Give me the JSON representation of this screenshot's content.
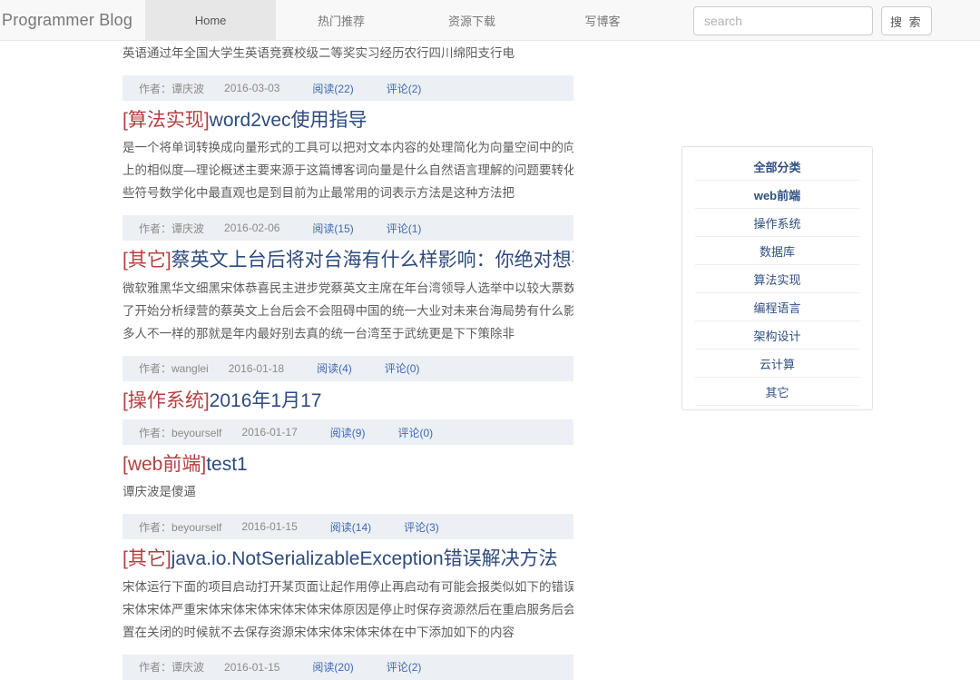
{
  "navbar": {
    "brand": "Programmer Blog",
    "items": [
      {
        "label": "Home",
        "active": true
      },
      {
        "label": "热门推荐",
        "active": false
      },
      {
        "label": "资源下载",
        "active": false
      },
      {
        "label": "写博客",
        "active": false
      }
    ],
    "search": {
      "placeholder": "search",
      "value": "",
      "button_label": "搜 索"
    }
  },
  "articles": [
    {
      "category": "",
      "title": "",
      "body_lines": [
        "英语通过年全国大学生英语竞赛校级二等奖实习经历农行四川绵阳支行电"
      ],
      "meta": {
        "author_label": "作者：",
        "author": "谭庆波",
        "date": "2016-03-03",
        "read": "阅读(22)",
        "comment": "评论(2)"
      }
    },
    {
      "category": "[算法实现]",
      "title": "word2vec使用指导",
      "body_lines": [
        "是一个将单词转换成向量形式的工具可以把对文本内容的处理简化为向量空间中的向量运算计算",
        "上的相似度—理论概述主要来源于这篇博客词向量是什么自然语言理解的问题要转化为机器学习",
        "些符号数学化中最直观也是到目前为止最常用的词表示方法是这种方法把"
      ],
      "meta": {
        "author_label": "作者：",
        "author": "谭庆波",
        "date": "2016-02-06",
        "read": "阅读(15)",
        "comment": "评论(1)"
      }
    },
    {
      "category": "[其它]",
      "title": "蔡英文上台后将对台海有什么样影响：你绝对想不到",
      "body_lines": [
        "微软雅黑华文细黑宋体恭喜民主进步党蔡英文主席在年台湾领导人选举中以较大票数优势成功当",
        "了开始分析绿营的蔡英文上台后会不会阻碍中国的统一大业对未来台海局势有什么影响微软雅黑",
        "多人不一样的那就是年内最好别去真的统一台湾至于武统更是下下策除非"
      ],
      "meta": {
        "author_label": "作者：",
        "author": "wanglei",
        "date": "2016-01-18",
        "read": "阅读(4)",
        "comment": "评论(0)"
      }
    },
    {
      "category": "[操作系统]",
      "title": "2016年1月17",
      "body_lines": [],
      "meta": {
        "author_label": "作者：",
        "author": "beyourself",
        "date": "2016-01-17",
        "read": "阅读(9)",
        "comment": "评论(0)"
      }
    },
    {
      "category": "[web前端]",
      "title": "test1",
      "body_lines": [
        "谭庆波是傻逼"
      ],
      "meta": {
        "author_label": "作者：",
        "author": "beyourself",
        "date": "2016-01-15",
        "read": "阅读(14)",
        "comment": "评论(3)"
      }
    },
    {
      "category": "[其它]",
      "title": "java.io.NotSerializableException错误解决方法",
      "body_lines": [
        "宋体运行下面的项目启动打开某页面让起作用停止再启动有可能会报类似如下的错误宋体宋体安",
        "宋体宋体严重宋体宋体宋体宋体宋体宋体原因是停止时保存资源然后在重启服务后会尝试恢复安",
        "置在关闭的时候就不去保存资源宋体宋体宋体宋体在中下添加如下的内容"
      ],
      "meta": {
        "author_label": "作者：",
        "author": "谭庆波",
        "date": "2016-01-15",
        "read": "阅读(20)",
        "comment": "评论(2)"
      }
    }
  ],
  "sidebar": {
    "categories": [
      {
        "label": "全部分类",
        "bold": true
      },
      {
        "label": "web前端",
        "bold": true
      },
      {
        "label": "操作系统",
        "bold": false
      },
      {
        "label": "数据库",
        "bold": false
      },
      {
        "label": "算法实现",
        "bold": false
      },
      {
        "label": "编程语言",
        "bold": false
      },
      {
        "label": "架构设计",
        "bold": false
      },
      {
        "label": "云计算",
        "bold": false
      },
      {
        "label": "其它",
        "bold": false
      }
    ]
  },
  "colors": {
    "category_prefix": "#b34040",
    "title": "#2e4a7d",
    "link": "#3c6ab5",
    "meta_bg": "#eceff3",
    "navbar_bg": "#f8f8f8",
    "nav_active_bg": "#e7e7e7"
  }
}
